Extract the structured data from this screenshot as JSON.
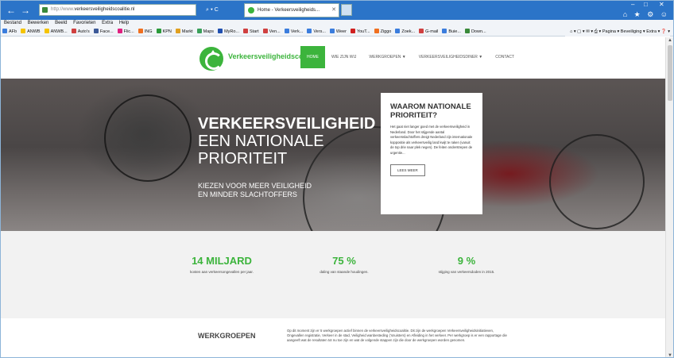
{
  "browser": {
    "address_url_prefix": "http://www.",
    "address_url_main": "verkeersveiligheidscoalitie.nl",
    "address_tools": "⌕ ▾ C",
    "tab_title": "Home - Verkeersveiligheids...",
    "menubar": [
      "Bestand",
      "Bewerken",
      "Beeld",
      "Favorieten",
      "Extra",
      "Help"
    ],
    "favorites": [
      {
        "label": "AFb",
        "color": "#3b7ddd"
      },
      {
        "label": "ANWB",
        "color": "#f5c400"
      },
      {
        "label": "ANWB...",
        "color": "#f5c400"
      },
      {
        "label": "Auto's",
        "color": "#d04040"
      },
      {
        "label": "Face...",
        "color": "#3b5998"
      },
      {
        "label": "Flic...",
        "color": "#e02080"
      },
      {
        "label": "ING",
        "color": "#f07020"
      },
      {
        "label": "KPN",
        "color": "#2a9a3a"
      },
      {
        "label": "Markt",
        "color": "#e0a020"
      },
      {
        "label": "Maps",
        "color": "#3aa05a"
      },
      {
        "label": "MyRo...",
        "color": "#2050b0"
      },
      {
        "label": "Start",
        "color": "#d04040"
      },
      {
        "label": "Ven...",
        "color": "#d04040"
      },
      {
        "label": "Verk...",
        "color": "#3b7ddd"
      },
      {
        "label": "Vers...",
        "color": "#3b7ddd"
      },
      {
        "label": "Weer",
        "color": "#3b7ddd"
      },
      {
        "label": "YouT...",
        "color": "#d02020"
      },
      {
        "label": "Ziggo",
        "color": "#f07020"
      },
      {
        "label": "Zoek...",
        "color": "#3b7ddd"
      },
      {
        "label": "G-mail",
        "color": "#d04040"
      },
      {
        "label": "Buie...",
        "color": "#3b7ddd"
      },
      {
        "label": "Down...",
        "color": "#3a8a3a"
      }
    ],
    "favbar_right": "⌂ ▾  ▢ ▾  ✉ ▾  ⎙ ▾  Pagina ▾  Beveiliging ▾  Extra ▾  ❓ ▾",
    "win_controls": [
      "–",
      "□",
      "✕"
    ],
    "toolbar_icons": "⌂ ★ ⚙ ☺"
  },
  "site": {
    "brand": "Verkeersveiligheidscoalitie",
    "menu": [
      "Home",
      "Wie zijn wij",
      "Werkgroepen ▼",
      "Verkeersveiligheidsdiner ▼",
      "Contact"
    ],
    "hero": {
      "title_line1": "VERKEERSVEILIGHEID",
      "title_line2": "EEN NATIONALE",
      "title_line3": "PRIORITEIT",
      "subtitle": "KIEZEN VOOR MEER VEILIGHEID EN MINDER SLACHTOFFERS"
    },
    "why_card": {
      "title": "WAAROM NATIONALE PRIORITEIT?",
      "body": "Het gaat niet langer goed met de verkeersveiligheid in Nederland. Door het stijgende aantal verkeersslachtoffers dreigt Nederland zijn internationale koppositie als verkeersveilig land kwijt te raken (vanuit de top drie naar plek negen). De feiten onderstrepen de urgentie...",
      "button": "LEES MEER"
    },
    "stats": [
      {
        "num": "14 MILJARD",
        "label": "kosten aan verkeersongevallen per jaar."
      },
      {
        "num": "75 %",
        "label": "daling van staande houdingen."
      },
      {
        "num": "9 %",
        "label": "stijging van verkeersdoden in 2015."
      }
    ],
    "work": {
      "title": "WERKGROEPEN",
      "text": "Op dit moment zijn er 5 werkgroepen actief binnen de verkeersveiligheidscoalitie. Dit zijn de werkgroepen Verkeersveiligheidsinitiatieven, Ongevallen registratie, Verkeer in de stad, Veiligheid wanbesteding (‘snuisters) en Afleiding in het verkeer. Per werkgroep is er een rapportage die aangeeft wat de resultaten tot nu toe zijn en wat de volgende stappen zijn die door de werkgroepen worden genomen."
    }
  }
}
